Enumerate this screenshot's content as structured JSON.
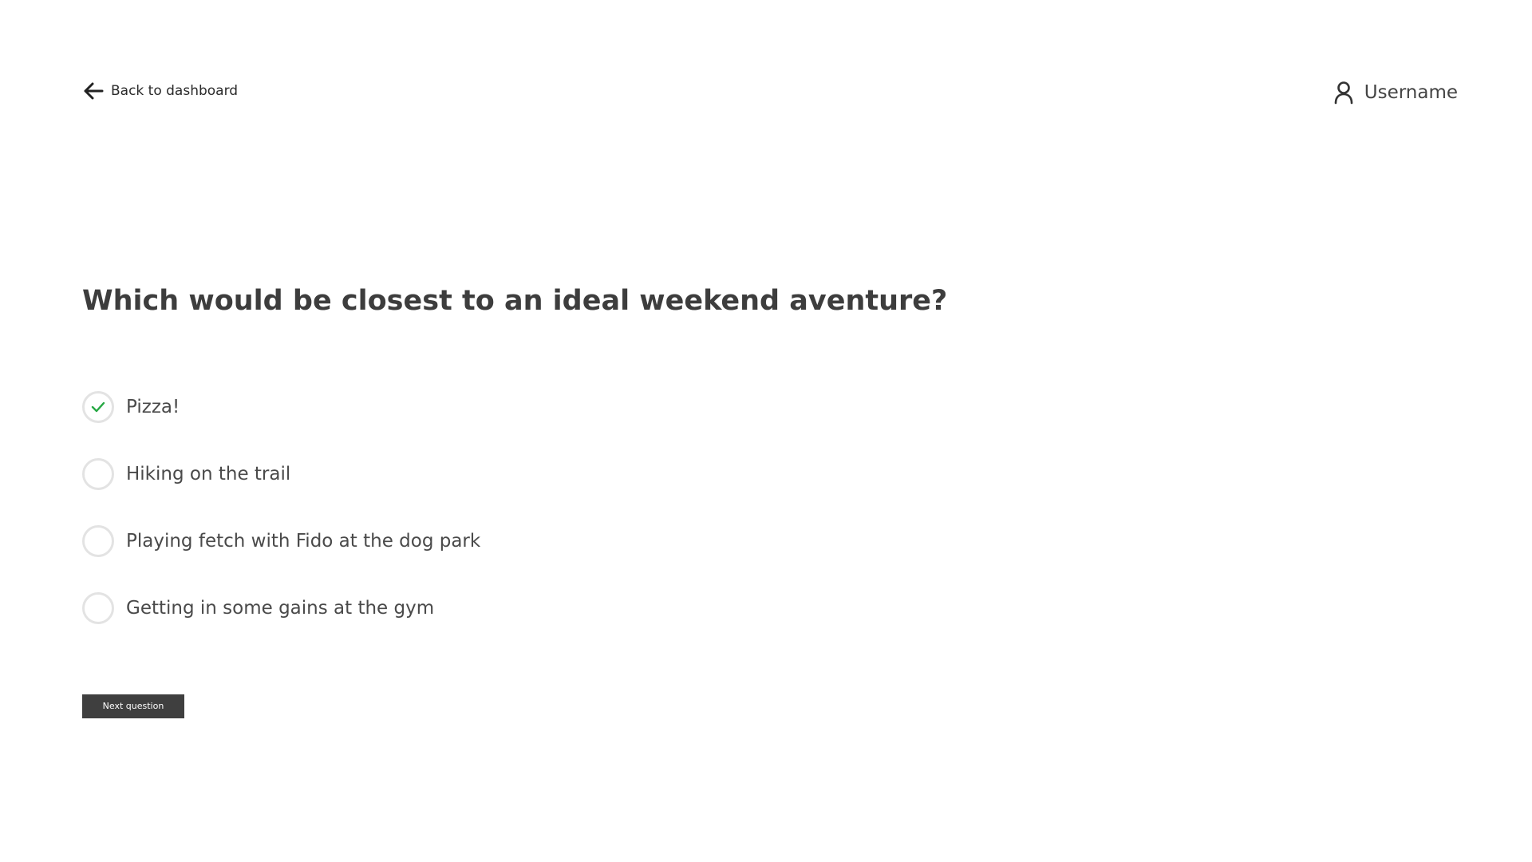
{
  "header": {
    "back_label": "Back to dashboard",
    "back_icon": "arrow-left-icon",
    "user_icon": "user-icon",
    "username": "Username"
  },
  "quiz": {
    "question": "Which would be closest to an ideal weekend aventure?",
    "options": [
      {
        "label": "Pizza!",
        "selected": true
      },
      {
        "label": "Hiking on the trail",
        "selected": false
      },
      {
        "label": "Playing fetch with Fido at the dog park",
        "selected": false
      },
      {
        "label": "Getting in some gains at the gym",
        "selected": false
      }
    ],
    "next_label": "Next question"
  },
  "colors": {
    "text": "#3d3d3d",
    "radio_border": "#e3e3e3",
    "check": "#27a844",
    "button_bg": "#3f3f3f",
    "button_text": "#ffffff"
  }
}
